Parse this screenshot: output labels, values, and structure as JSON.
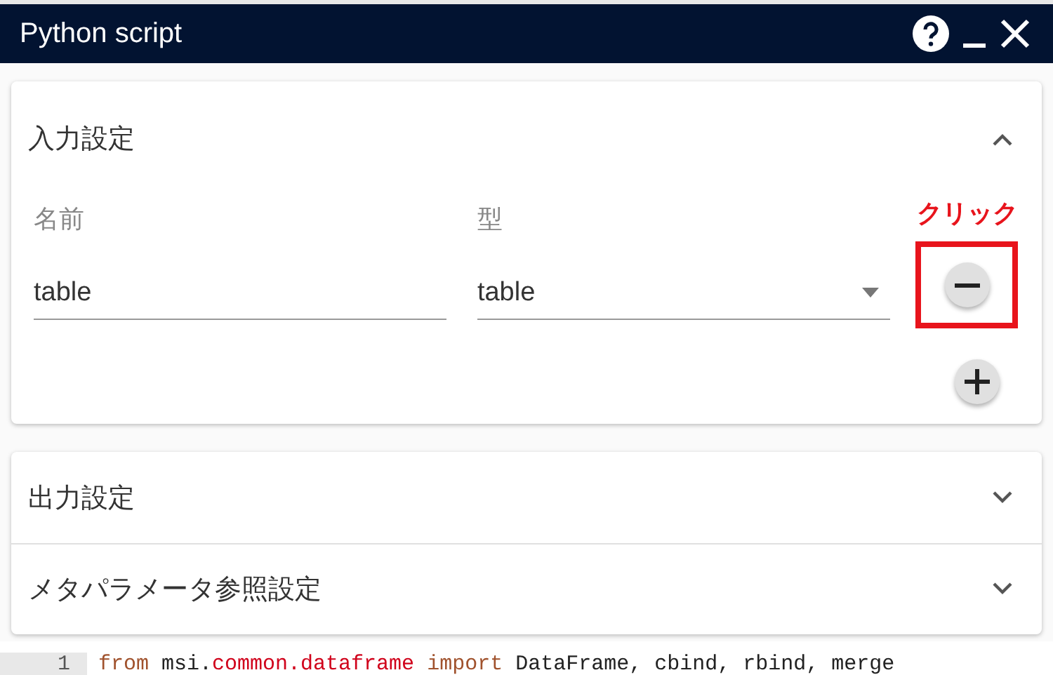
{
  "window": {
    "title": "Python script"
  },
  "input_settings": {
    "title": "入力設定",
    "expanded": true,
    "columns": [
      "名前",
      "型"
    ],
    "rows": [
      {
        "name": "table",
        "type": "table"
      }
    ],
    "annotation": "クリック"
  },
  "sections": [
    {
      "title": "出力設定",
      "expanded": false
    },
    {
      "title": "メタパラメータ参照設定",
      "expanded": false
    }
  ],
  "code": {
    "line_number": "1",
    "tokens": [
      {
        "text": "from",
        "kind": "keyword"
      },
      {
        "text": " msi.",
        "kind": "plain"
      },
      {
        "text": "common.dataframe",
        "kind": "module"
      },
      {
        "text": " import",
        "kind": "keyword"
      },
      {
        "text": " DataFrame, cbind, rbind, merge",
        "kind": "plain"
      }
    ]
  }
}
